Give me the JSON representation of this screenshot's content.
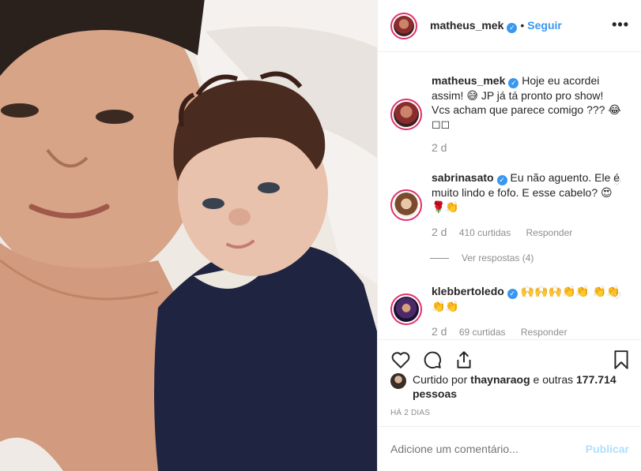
{
  "post": {
    "username": "matheus_mek",
    "follow_label": "Seguir",
    "dot": "•",
    "more_label": "•••"
  },
  "caption": {
    "username": "matheus_mek",
    "text": "Hoje eu acordei assim! 😅 JP já tá pronto pro show! Vcs acham que parece comigo ??? 😂 ◻◻",
    "age": "2 d"
  },
  "comments": [
    {
      "username": "sabrinasato",
      "text": "Eu não aguento. Ele é muito lindo e fofo. E esse cabelo? 😍🌹👏",
      "age": "2 d",
      "likes": "410 curtidas",
      "reply_label": "Responder",
      "view_replies": "Ver respostas (4)"
    },
    {
      "username": "klebbertoledo",
      "text": "🙌🙌🙌👏👏 👏👏👏👏",
      "age": "2 d",
      "likes": "69 curtidas",
      "reply_label": "Responder"
    }
  ],
  "likes_line": {
    "prefix": "Curtido por ",
    "user": "thaynaraog",
    "middle": " e outras ",
    "count": "177.714",
    "suffix": " pessoas"
  },
  "timestamp": "HÁ 2 DIAS",
  "comment_box": {
    "placeholder": "Adicione um comentário...",
    "publish_label": "Publicar"
  },
  "icons": [
    "heart-icon",
    "comment-icon",
    "share-icon",
    "bookmark-icon",
    "verified-icon",
    "more-icon"
  ],
  "colors": {
    "accent": "#3897f0",
    "publish_disabled": "#b2dffc",
    "muted": "#8e8e8e",
    "text": "#262626"
  }
}
